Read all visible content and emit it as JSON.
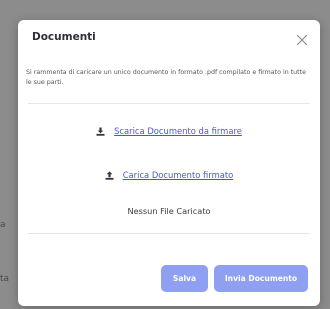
{
  "backdrop": {
    "fragment_1": "a",
    "fragment_2": "ta"
  },
  "modal": {
    "title": "Documenti",
    "close_icon": "close-icon",
    "notice": "Si rammenta di caricare un unico documento in formato .pdf compilato e firmato in tutte le sue parti.",
    "download": {
      "icon": "download-icon",
      "label": "Scarica Documento da firmare"
    },
    "upload": {
      "icon": "upload-icon",
      "label": "Carica Documento firmato"
    },
    "file_status": "Nessun File Caricato",
    "buttons": {
      "save_label": "Salva",
      "send_label": "Invia Documento"
    }
  },
  "colors": {
    "overlay": "#8c8c8c",
    "accent_button": "#8f9ff2",
    "link": "#3d5bd8"
  }
}
